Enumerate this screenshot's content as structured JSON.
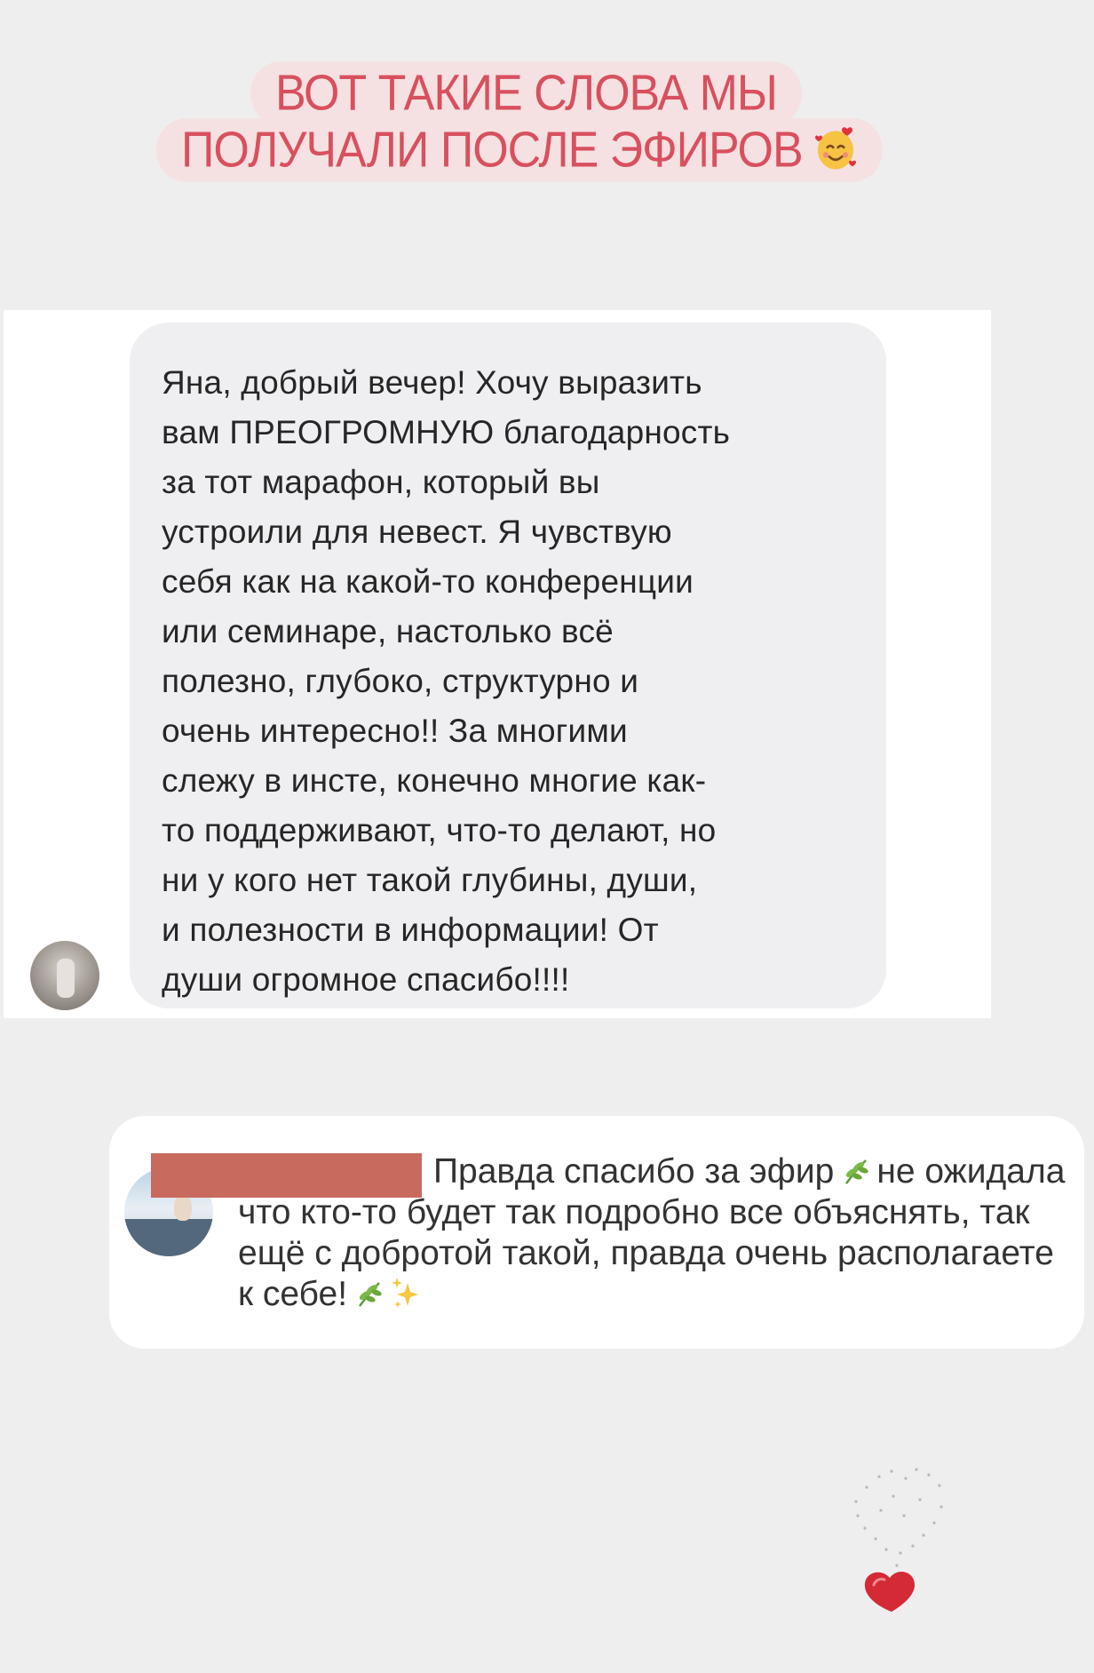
{
  "header": {
    "line1": "ВОТ ТАКИЕ СЛОВА МЫ",
    "line2": "ПОЛУЧАЛИ ПОСЛЕ ЭФИРОВ",
    "emoji": "smiling-face-with-hearts-icon"
  },
  "message_card": {
    "text": "Яна, добрый вечер! Хочу выразить\nвам ПРЕОГРОМНУЮ благодарность\nза тот марафон, который вы\nустроили для невест. Я чувствую\nсебя как на какой-то конференции\nили семинаре, настолько всё\nполезно, глубоко, структурно и\nочень интересно!! За многими\nслежу в инсте, конечно многие как-\nто поддерживают, что-то делают, но\nни у кого нет такой глубины, души,\nи полезности в информации! От\nдуши огромное спасибо!!!!",
    "avatar": "sender-avatar"
  },
  "comment_card": {
    "text_part1": "Правда спасибо за эфир",
    "text_part2": "не ожидала что кто-то будет так подробно все объяснять, так ещё с добротой такой, правда очень располагаете к себе!",
    "icons": [
      "herb-icon",
      "herb-icon",
      "sparkles-icon"
    ],
    "username_redacted": true
  },
  "colors": {
    "background": "#efeeee",
    "title_text": "#d8505f",
    "title_bg": "#f5e1e1",
    "bubble_bg": "#efeef1",
    "redaction": "#c96a5e",
    "heart": "#d42a35"
  }
}
